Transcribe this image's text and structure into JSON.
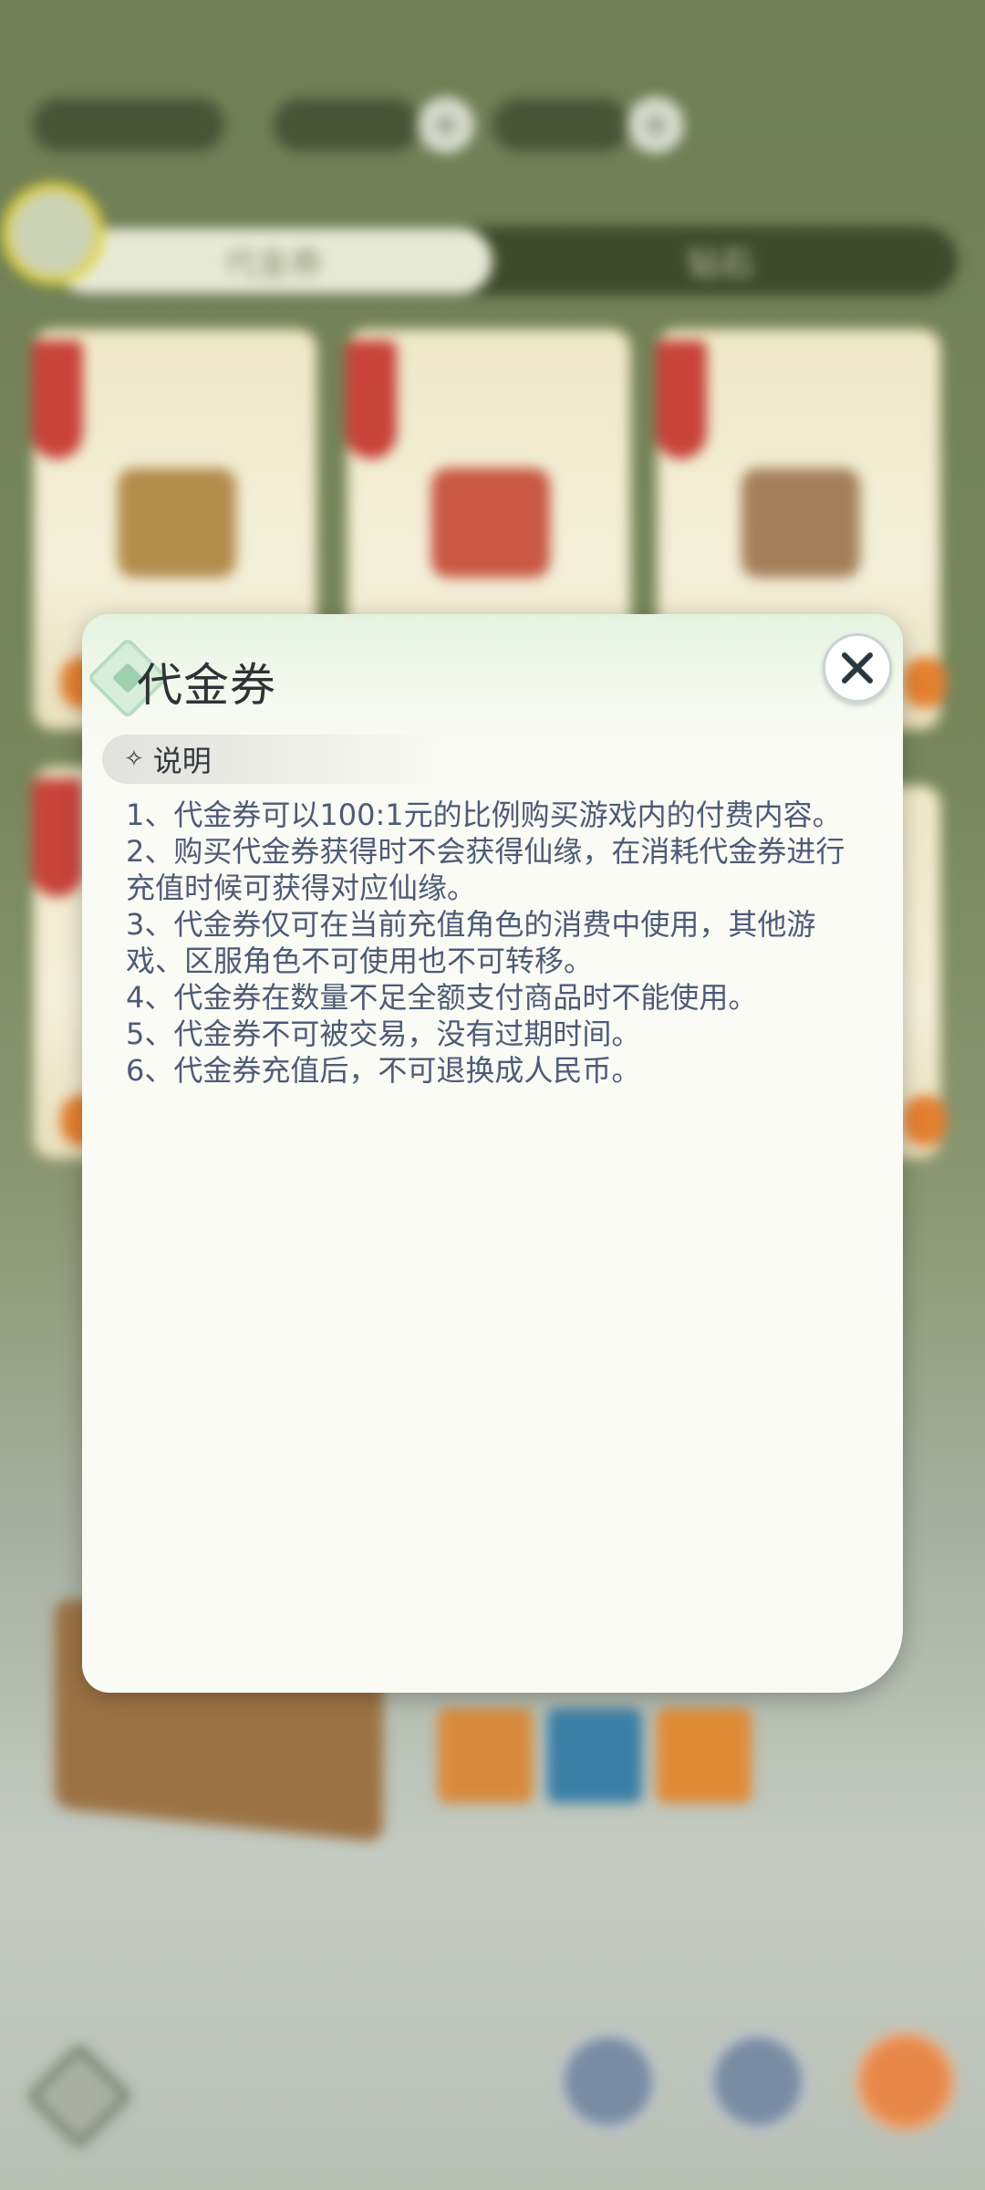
{
  "modal": {
    "title": "代金券",
    "section_label": "说明",
    "section_icon": "diamond-sparkle-icon",
    "close_icon": "close-icon",
    "items": [
      "1、代金券可以100:1元的比例购买游戏内的付费内容。",
      "2、购买代金券获得时不会获得仙缘，在消耗代金券进行充值时候可获得对应仙缘。",
      "3、代金券仅可在当前充值角色的消费中使用，其他游戏、区服角色不可使用也不可转移。",
      "4、代金券在数量不足全额支付商品时不能使用。",
      "5、代金券不可被交易，没有过期时间。",
      "6、代金券充值后，不可退换成人民币。"
    ]
  },
  "background": {
    "tabs": [
      "代金券",
      "钻石"
    ]
  },
  "colors": {
    "modal_bg": "#fbfbf5",
    "body_text": "#4e5b76",
    "title_text": "#2f3337",
    "close_icon": "#2b3740"
  }
}
